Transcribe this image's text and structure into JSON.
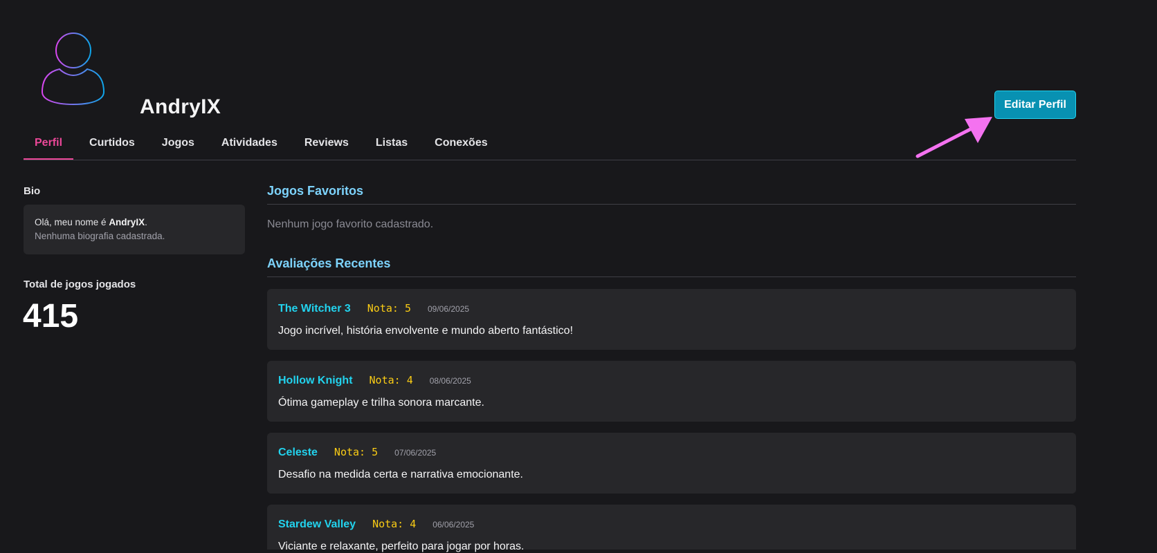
{
  "profile": {
    "username": "AndryIX",
    "edit_button": "Editar Perfil"
  },
  "tabs": [
    {
      "label": "Perfil",
      "active": true
    },
    {
      "label": "Curtidos"
    },
    {
      "label": "Jogos"
    },
    {
      "label": "Atividades"
    },
    {
      "label": "Reviews"
    },
    {
      "label": "Listas"
    },
    {
      "label": "Conexões"
    }
  ],
  "bio": {
    "label": "Bio",
    "greeting_prefix": "Olá, meu nome é ",
    "greeting_name": "AndryIX",
    "greeting_suffix": ".",
    "empty": "Nenhuma biografia cadastrada."
  },
  "stats": {
    "total_label": "Total de jogos jogados",
    "total_value": "415"
  },
  "favorites": {
    "title": "Jogos Favoritos",
    "empty": "Nenhum jogo favorito cadastrado."
  },
  "reviews": {
    "title": "Avaliações Recentes",
    "items": [
      {
        "game": "The Witcher 3",
        "rating": "Nota: 5",
        "date": "09/06/2025",
        "text": "Jogo incrível, história envolvente e mundo aberto fantástico!"
      },
      {
        "game": "Hollow Knight",
        "rating": "Nota: 4",
        "date": "08/06/2025",
        "text": "Ótima gameplay e trilha sonora marcante."
      },
      {
        "game": "Celeste",
        "rating": "Nota: 5",
        "date": "07/06/2025",
        "text": "Desafio na medida certa e narrativa emocionante."
      },
      {
        "game": "Stardew Valley",
        "rating": "Nota: 4",
        "date": "06/06/2025",
        "text": "Viciante e relaxante, perfeito para jogar por horas."
      }
    ]
  },
  "colors": {
    "background": "#18181b",
    "accent_pink": "#ec4899",
    "accent_cyan": "#22d3ee",
    "rating_yellow": "#facc15",
    "button": "#0891b2"
  },
  "icons": {
    "avatar": "user-outline-gradient-icon",
    "annotation": "pink-arrow-icon"
  }
}
